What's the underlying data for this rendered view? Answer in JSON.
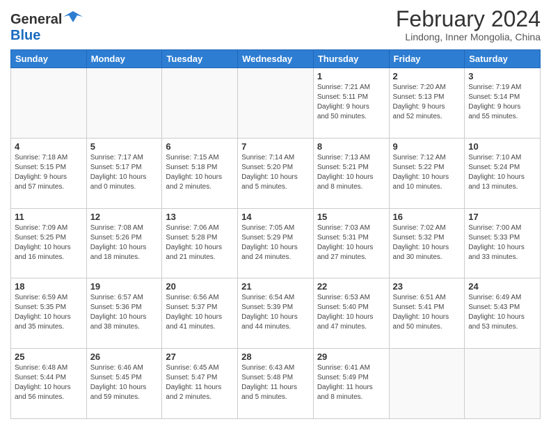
{
  "header": {
    "logo": {
      "general": "General",
      "blue": "Blue"
    },
    "title": "February 2024",
    "location": "Lindong, Inner Mongolia, China"
  },
  "days_of_week": [
    "Sunday",
    "Monday",
    "Tuesday",
    "Wednesday",
    "Thursday",
    "Friday",
    "Saturday"
  ],
  "weeks": [
    [
      {
        "day": "",
        "info": ""
      },
      {
        "day": "",
        "info": ""
      },
      {
        "day": "",
        "info": ""
      },
      {
        "day": "",
        "info": ""
      },
      {
        "day": "1",
        "info": "Sunrise: 7:21 AM\nSunset: 5:11 PM\nDaylight: 9 hours\nand 50 minutes."
      },
      {
        "day": "2",
        "info": "Sunrise: 7:20 AM\nSunset: 5:13 PM\nDaylight: 9 hours\nand 52 minutes."
      },
      {
        "day": "3",
        "info": "Sunrise: 7:19 AM\nSunset: 5:14 PM\nDaylight: 9 hours\nand 55 minutes."
      }
    ],
    [
      {
        "day": "4",
        "info": "Sunrise: 7:18 AM\nSunset: 5:15 PM\nDaylight: 9 hours\nand 57 minutes."
      },
      {
        "day": "5",
        "info": "Sunrise: 7:17 AM\nSunset: 5:17 PM\nDaylight: 10 hours\nand 0 minutes."
      },
      {
        "day": "6",
        "info": "Sunrise: 7:15 AM\nSunset: 5:18 PM\nDaylight: 10 hours\nand 2 minutes."
      },
      {
        "day": "7",
        "info": "Sunrise: 7:14 AM\nSunset: 5:20 PM\nDaylight: 10 hours\nand 5 minutes."
      },
      {
        "day": "8",
        "info": "Sunrise: 7:13 AM\nSunset: 5:21 PM\nDaylight: 10 hours\nand 8 minutes."
      },
      {
        "day": "9",
        "info": "Sunrise: 7:12 AM\nSunset: 5:22 PM\nDaylight: 10 hours\nand 10 minutes."
      },
      {
        "day": "10",
        "info": "Sunrise: 7:10 AM\nSunset: 5:24 PM\nDaylight: 10 hours\nand 13 minutes."
      }
    ],
    [
      {
        "day": "11",
        "info": "Sunrise: 7:09 AM\nSunset: 5:25 PM\nDaylight: 10 hours\nand 16 minutes."
      },
      {
        "day": "12",
        "info": "Sunrise: 7:08 AM\nSunset: 5:26 PM\nDaylight: 10 hours\nand 18 minutes."
      },
      {
        "day": "13",
        "info": "Sunrise: 7:06 AM\nSunset: 5:28 PM\nDaylight: 10 hours\nand 21 minutes."
      },
      {
        "day": "14",
        "info": "Sunrise: 7:05 AM\nSunset: 5:29 PM\nDaylight: 10 hours\nand 24 minutes."
      },
      {
        "day": "15",
        "info": "Sunrise: 7:03 AM\nSunset: 5:31 PM\nDaylight: 10 hours\nand 27 minutes."
      },
      {
        "day": "16",
        "info": "Sunrise: 7:02 AM\nSunset: 5:32 PM\nDaylight: 10 hours\nand 30 minutes."
      },
      {
        "day": "17",
        "info": "Sunrise: 7:00 AM\nSunset: 5:33 PM\nDaylight: 10 hours\nand 33 minutes."
      }
    ],
    [
      {
        "day": "18",
        "info": "Sunrise: 6:59 AM\nSunset: 5:35 PM\nDaylight: 10 hours\nand 35 minutes."
      },
      {
        "day": "19",
        "info": "Sunrise: 6:57 AM\nSunset: 5:36 PM\nDaylight: 10 hours\nand 38 minutes."
      },
      {
        "day": "20",
        "info": "Sunrise: 6:56 AM\nSunset: 5:37 PM\nDaylight: 10 hours\nand 41 minutes."
      },
      {
        "day": "21",
        "info": "Sunrise: 6:54 AM\nSunset: 5:39 PM\nDaylight: 10 hours\nand 44 minutes."
      },
      {
        "day": "22",
        "info": "Sunrise: 6:53 AM\nSunset: 5:40 PM\nDaylight: 10 hours\nand 47 minutes."
      },
      {
        "day": "23",
        "info": "Sunrise: 6:51 AM\nSunset: 5:41 PM\nDaylight: 10 hours\nand 50 minutes."
      },
      {
        "day": "24",
        "info": "Sunrise: 6:49 AM\nSunset: 5:43 PM\nDaylight: 10 hours\nand 53 minutes."
      }
    ],
    [
      {
        "day": "25",
        "info": "Sunrise: 6:48 AM\nSunset: 5:44 PM\nDaylight: 10 hours\nand 56 minutes."
      },
      {
        "day": "26",
        "info": "Sunrise: 6:46 AM\nSunset: 5:45 PM\nDaylight: 10 hours\nand 59 minutes."
      },
      {
        "day": "27",
        "info": "Sunrise: 6:45 AM\nSunset: 5:47 PM\nDaylight: 11 hours\nand 2 minutes."
      },
      {
        "day": "28",
        "info": "Sunrise: 6:43 AM\nSunset: 5:48 PM\nDaylight: 11 hours\nand 5 minutes."
      },
      {
        "day": "29",
        "info": "Sunrise: 6:41 AM\nSunset: 5:49 PM\nDaylight: 11 hours\nand 8 minutes."
      },
      {
        "day": "",
        "info": ""
      },
      {
        "day": "",
        "info": ""
      }
    ]
  ]
}
